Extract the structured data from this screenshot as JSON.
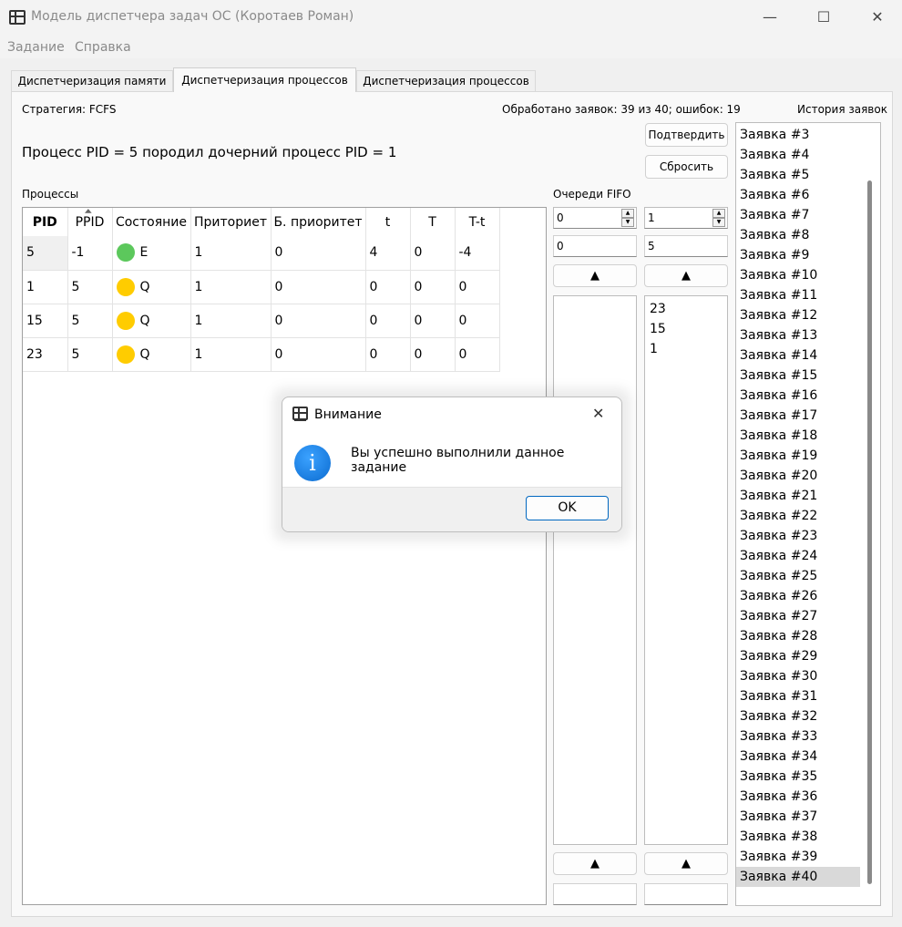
{
  "window": {
    "title": "Модель диспетчера задач ОС (Коротаев Роман)",
    "minimize_glyph": "—",
    "maximize_glyph": "☐",
    "close_glyph": "✕"
  },
  "menu": {
    "items": [
      "Задание",
      "Справка"
    ]
  },
  "tabs": [
    {
      "label": "Диспетчеризация памяти",
      "active": false
    },
    {
      "label": "Диспетчеризация процессов",
      "active": true
    },
    {
      "label": "Диспетчеризация процессов",
      "active": false
    }
  ],
  "main": {
    "strategy": "Стратегия: FCFS",
    "processed": "Обработано заявок: 39 из 40; ошибок: 19",
    "history_label": "История заявок",
    "message": "Процесс PID = 5 породил дочерний процесс PID = 1",
    "confirm_button": "Подтвердить",
    "reset_button": "Сбросить",
    "processes_label": "Процессы",
    "queues_label": "Очереди FIFO"
  },
  "table": {
    "headers": [
      "PID",
      "PPID",
      "Состояние",
      "Приториет",
      "Б. приоритет",
      "t",
      "T",
      "T-t"
    ],
    "rows": [
      {
        "pid": "5",
        "ppid": "-1",
        "state": "E",
        "state_color": "#5cc85c",
        "prio": "1",
        "bprio": "0",
        "t": "4",
        "T": "0",
        "Tt": "-4"
      },
      {
        "pid": "1",
        "ppid": "5",
        "state": "Q",
        "state_color": "#ffcc00",
        "prio": "1",
        "bprio": "0",
        "t": "0",
        "T": "0",
        "Tt": "0"
      },
      {
        "pid": "15",
        "ppid": "5",
        "state": "Q",
        "state_color": "#ffcc00",
        "prio": "1",
        "bprio": "0",
        "t": "0",
        "T": "0",
        "Tt": "0"
      },
      {
        "pid": "23",
        "ppid": "5",
        "state": "Q",
        "state_color": "#ffcc00",
        "prio": "1",
        "bprio": "0",
        "t": "0",
        "T": "0",
        "Tt": "0"
      }
    ]
  },
  "queues": [
    {
      "spin_value": "0",
      "edit_value": "0",
      "top_button": "▲",
      "bottom_button": "▲",
      "bottom_edit": "",
      "items": []
    },
    {
      "spin_value": "1",
      "edit_value": "5",
      "top_button": "▲",
      "bottom_button": "▲",
      "bottom_edit": "",
      "items": [
        "23",
        "15",
        "1"
      ]
    }
  ],
  "history": {
    "items": [
      "Заявка #3",
      "Заявка #4",
      "Заявка #5",
      "Заявка #6",
      "Заявка #7",
      "Заявка #8",
      "Заявка #9",
      "Заявка #10",
      "Заявка #11",
      "Заявка #12",
      "Заявка #13",
      "Заявка #14",
      "Заявка #15",
      "Заявка #16",
      "Заявка #17",
      "Заявка #18",
      "Заявка #19",
      "Заявка #20",
      "Заявка #21",
      "Заявка #22",
      "Заявка #23",
      "Заявка #24",
      "Заявка #25",
      "Заявка #26",
      "Заявка #27",
      "Заявка #28",
      "Заявка #29",
      "Заявка #30",
      "Заявка #31",
      "Заявка #32",
      "Заявка #33",
      "Заявка #34",
      "Заявка #35",
      "Заявка #36",
      "Заявка #37",
      "Заявка #38",
      "Заявка #39",
      "Заявка #40"
    ],
    "selected": "Заявка #40"
  },
  "dialog": {
    "title": "Внимание",
    "message": "Вы успешно выполнили данное задание",
    "ok_button": "OK",
    "close_glyph": "✕",
    "info_glyph": "i"
  }
}
